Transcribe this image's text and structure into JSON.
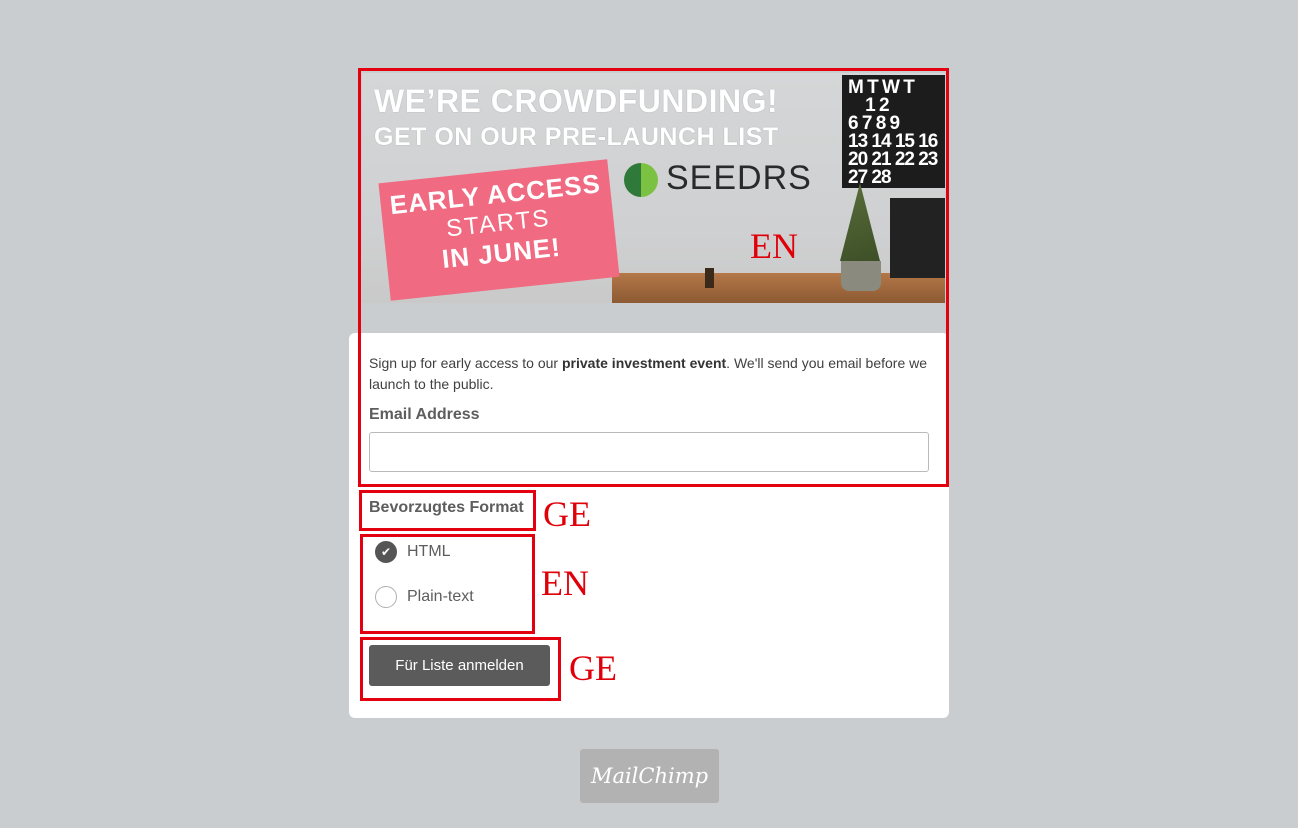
{
  "banner": {
    "headline_1": "WE’RE CROWDFUNDING!",
    "headline_2": "GET ON OUR PRE-LAUNCH LIST",
    "badge_line_1": "EARLY ACCESS",
    "badge_line_2": "STARTS",
    "badge_line_3": "IN JUNE!",
    "partner": "SEEDRS",
    "calendar_text": "M T W T\n    1 2\n6 7 8 9\n13 14 15 16\n20 21 22 23\n27 28"
  },
  "form": {
    "description_pre": "Sign up for early access to our ",
    "description_bold": "private investment event",
    "description_post": ". We'll send you email before we launch to the public.",
    "email_label": "Email Address",
    "email_value": "",
    "format_label": "Bevorzugtes Format",
    "format_options": [
      {
        "label": "HTML",
        "selected": true
      },
      {
        "label": "Plain-text",
        "selected": false
      }
    ],
    "submit_label": "Für Liste anmelden"
  },
  "annotations": {
    "banner_lang": "EN",
    "format_label_lang": "GE",
    "format_options_lang": "EN",
    "submit_lang": "GE"
  },
  "footer": {
    "badge_text": "MailChimp"
  },
  "colors": {
    "background": "#c9cdd0",
    "annotation_red": "#e3000f",
    "button": "#5b5b5b",
    "badge_pink": "#f06b82"
  }
}
